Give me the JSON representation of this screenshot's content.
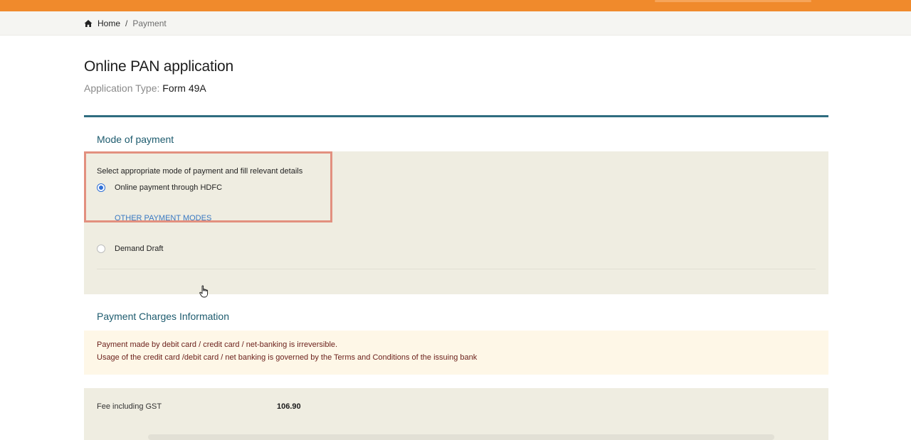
{
  "breadcrumb": {
    "home_icon": "home-icon",
    "home": "Home",
    "separator": "/",
    "current": "Payment"
  },
  "page": {
    "title": "Online PAN application",
    "application_type_label": "Application Type:",
    "application_type_value": "Form 49A"
  },
  "mode_of_payment": {
    "heading": "Mode of payment",
    "instruction": "Select appropriate mode of payment and fill relevant details",
    "options": [
      {
        "label": "Online payment through HDFC",
        "selected": true
      },
      {
        "label": "Demand Draft",
        "selected": false
      }
    ],
    "other_modes_link": "OTHER PAYMENT MODES"
  },
  "payment_charges": {
    "heading": "Payment Charges Information",
    "notice_lines": [
      "Payment made by debit card / credit card / net-banking is irreversible.",
      "Usage of the credit card /debit card / net banking is governed by the Terms and Conditions of the issuing bank"
    ],
    "fee_label": "Fee including GST",
    "fee_value": "106.90"
  },
  "colors": {
    "header_orange": "#f08a2c",
    "accent_teal": "#1d5b6e",
    "panel_beige": "#efede1",
    "highlight_border": "#e2907f",
    "link_blue": "#3a79c2"
  }
}
